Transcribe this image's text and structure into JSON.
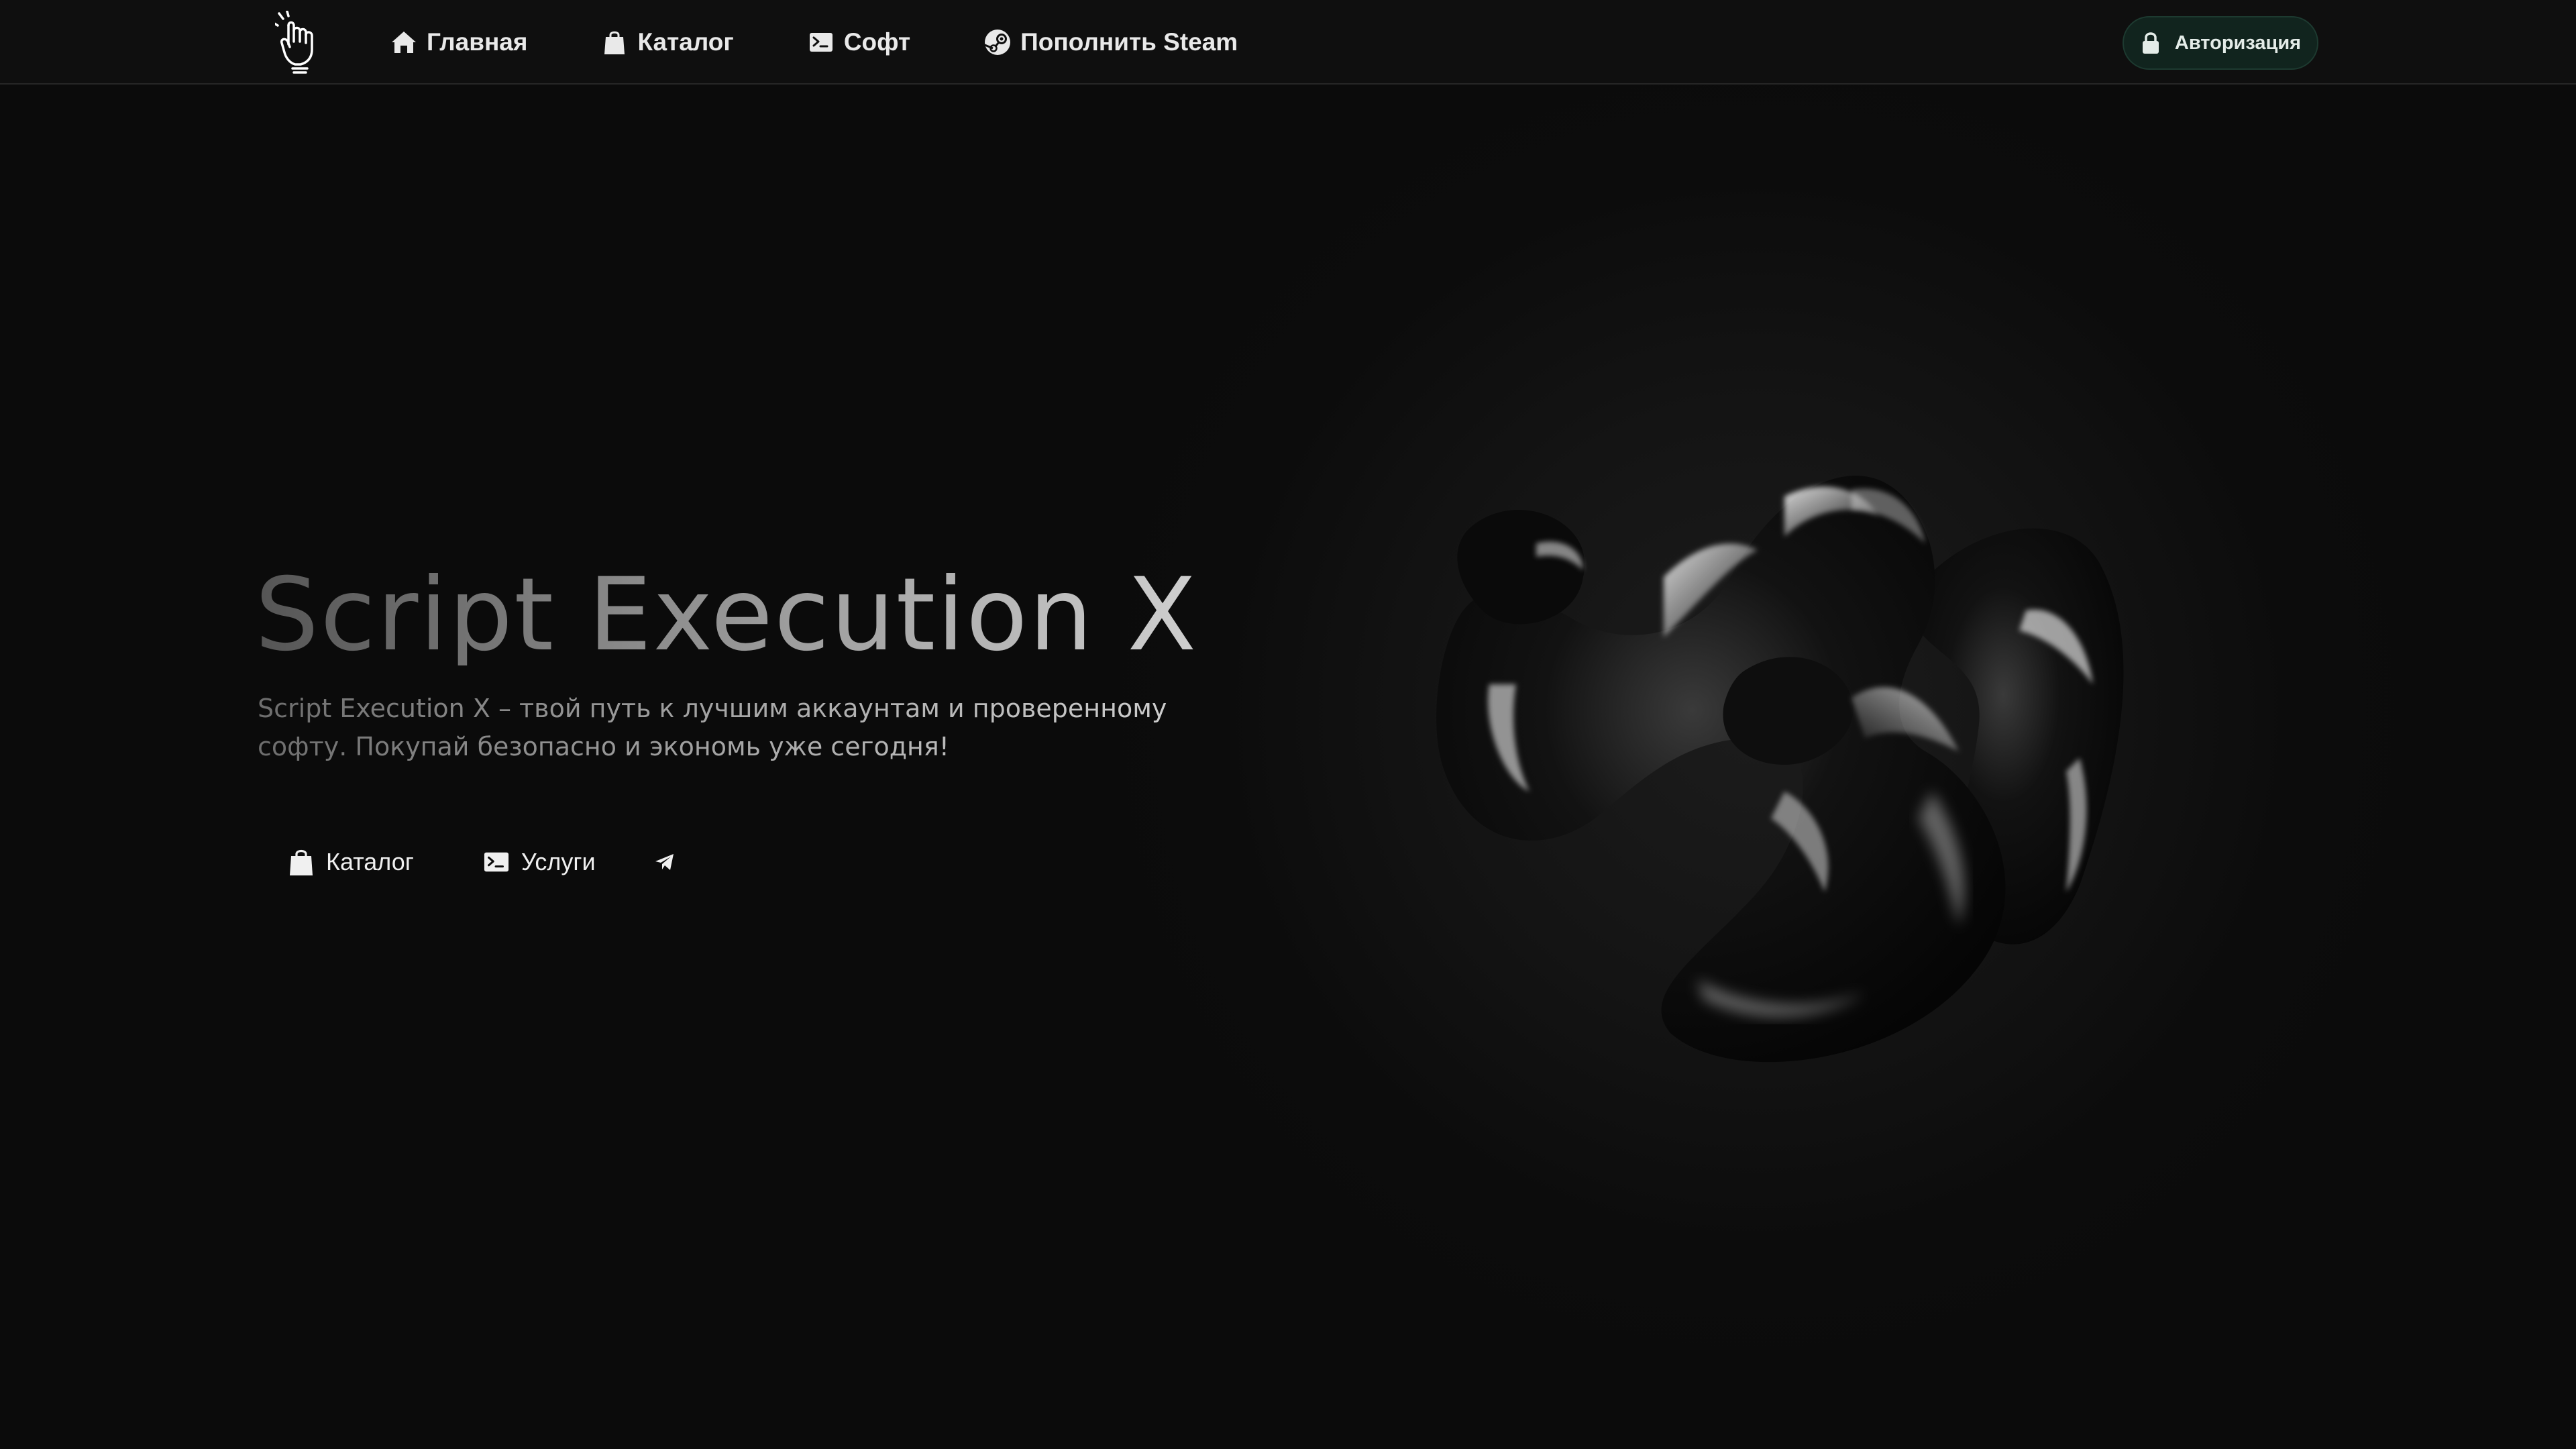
{
  "header": {
    "logo_icon": "hand-logo-icon",
    "nav": [
      {
        "label": "Главная",
        "icon": "home-icon"
      },
      {
        "label": "Каталог",
        "icon": "shopping-bag-icon"
      },
      {
        "label": "Софт",
        "icon": "terminal-icon"
      },
      {
        "label": "Пополнить Steam",
        "icon": "steam-icon"
      }
    ],
    "auth": {
      "label": "Авторизация",
      "icon": "lock-icon"
    }
  },
  "hero": {
    "title": "Script Execution X",
    "subtitle_line1": "Script Execution X – твой путь к лучшим аккаунтам и проверенному",
    "subtitle_line2": "софту. Покупай безопасно и экономь уже сегодня!",
    "buttons": [
      {
        "label": "Каталог",
        "icon": "shopping-bag-icon"
      },
      {
        "label": "Услуги",
        "icon": "terminal-icon"
      },
      {
        "label": "",
        "icon": "telegram-icon"
      }
    ]
  },
  "decor": {
    "image": "black-glossy-3d-blob"
  },
  "colors": {
    "background": "#0b0b0b",
    "header_bg": "#0f0f0f",
    "auth_button_bg": "#11241e",
    "text": "#e9e9e9"
  }
}
